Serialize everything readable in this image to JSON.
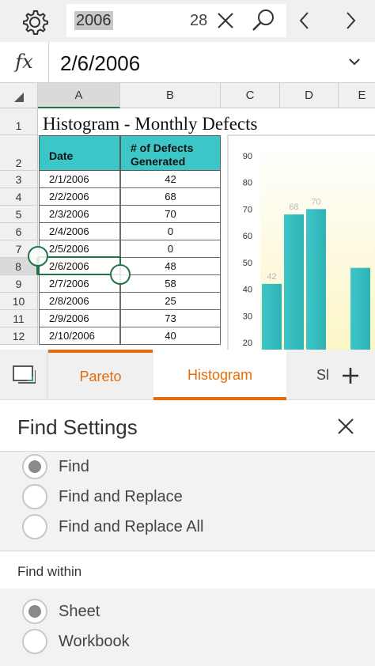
{
  "find_bar": {
    "search_value": "2006",
    "match_count": "28"
  },
  "formula_bar": {
    "fx_label": "fx",
    "value": "2/6/2006"
  },
  "columns": [
    "A",
    "B",
    "C",
    "D",
    "E"
  ],
  "rows": [
    "1",
    "2",
    "3",
    "4",
    "5",
    "6",
    "7",
    "8",
    "9",
    "10",
    "11",
    "12"
  ],
  "sheet": {
    "title": "Histogram - Monthly Defects",
    "header_date": "Date",
    "header_defects": "# of Defects Generated",
    "data": [
      {
        "date": "2/1/2006",
        "defects": "42"
      },
      {
        "date": "2/2/2006",
        "defects": "68"
      },
      {
        "date": "2/3/2006",
        "defects": "70"
      },
      {
        "date": "2/4/2006",
        "defects": "0"
      },
      {
        "date": "2/5/2006",
        "defects": "0"
      },
      {
        "date": "2/6/2006",
        "defects": "48"
      },
      {
        "date": "2/7/2006",
        "defects": "58"
      },
      {
        "date": "2/8/2006",
        "defects": "25"
      },
      {
        "date": "2/9/2006",
        "defects": "73"
      },
      {
        "date": "2/10/2006",
        "defects": "40"
      }
    ]
  },
  "chart_data": {
    "type": "bar",
    "title": "",
    "xlabel": "",
    "ylabel": "",
    "ylim": [
      15,
      95
    ],
    "yticks": [
      20,
      30,
      40,
      50,
      60,
      70,
      80,
      90
    ],
    "values": [
      42,
      68,
      70,
      0,
      48
    ],
    "data_labels": [
      "42",
      "68",
      "70"
    ],
    "bar_color": "#3cc6c8",
    "grid": false
  },
  "tabs": [
    {
      "label": "Pareto"
    },
    {
      "label": "Histogram"
    },
    {
      "label": "Sl"
    }
  ],
  "find_settings": {
    "title": "Find Settings",
    "mode_options": [
      {
        "label": "Find",
        "selected": true
      },
      {
        "label": "Find and Replace",
        "selected": false
      },
      {
        "label": "Find and Replace All",
        "selected": false
      }
    ],
    "within_label": "Find within",
    "within_options": [
      {
        "label": "Sheet",
        "selected": true
      },
      {
        "label": "Workbook",
        "selected": false
      }
    ]
  },
  "colors": {
    "accent_orange": "#e46c0a",
    "excel_green": "#217346",
    "header_teal": "#3cc6c8"
  }
}
